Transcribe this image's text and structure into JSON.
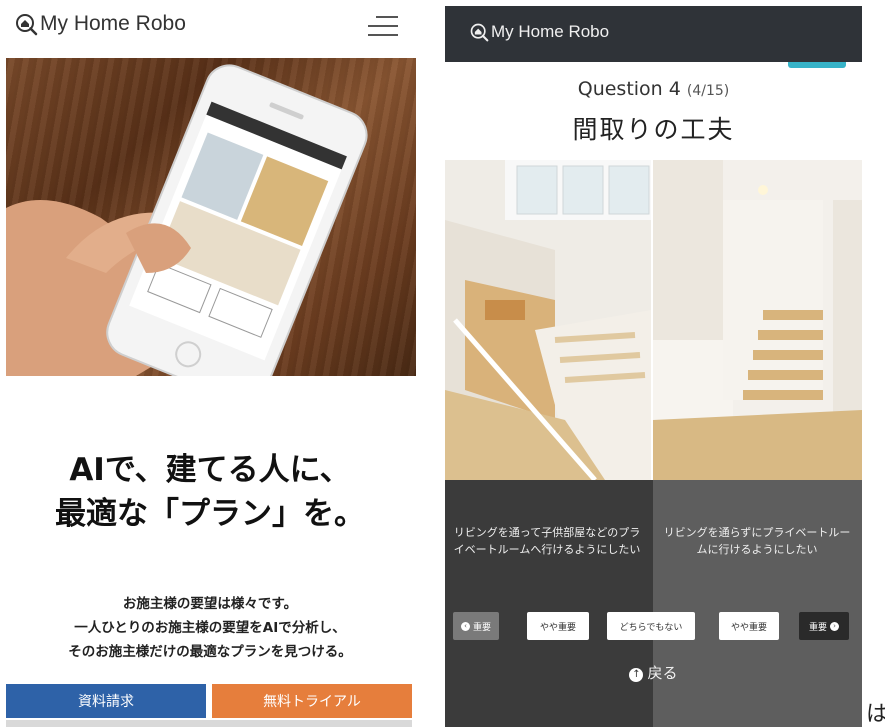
{
  "left_screen": {
    "brand": "My Home Robo",
    "headline_line1": "AIで、建てる人に、",
    "headline_line2": "最適な「プラン」を。",
    "desc_line1": "お施主様の要望は様々です。",
    "desc_line2": "一人ひとりのお施主様の要望をAIで分析し、",
    "desc_line3": "そのお施主様だけの最適なプランを見つける。",
    "cta_primary": "資料請求",
    "cta_secondary": "無料トライアル",
    "colors": {
      "cta_primary": "#2e62a8",
      "cta_secondary": "#e67e3c"
    }
  },
  "right_screen": {
    "brand": "My Home Robo",
    "question_label": "Question 4",
    "question_count": "(4/15)",
    "question_heading": "間取りの工夫",
    "option_a": "リビングを通って子供部屋などのプライベートルームへ行けるようにしたい",
    "option_b": "リビングを通らずにプライベートルームに行けるようにしたい",
    "scale": {
      "important_a": "重要",
      "somewhat_a": "やや重要",
      "neutral": "どちらでもない",
      "somewhat_b": "やや重要",
      "important_b": "重要"
    },
    "back_label": "戻る",
    "colors": {
      "header": "#2f3338",
      "accent": "#37b3c8"
    }
  },
  "stray_text": "は"
}
